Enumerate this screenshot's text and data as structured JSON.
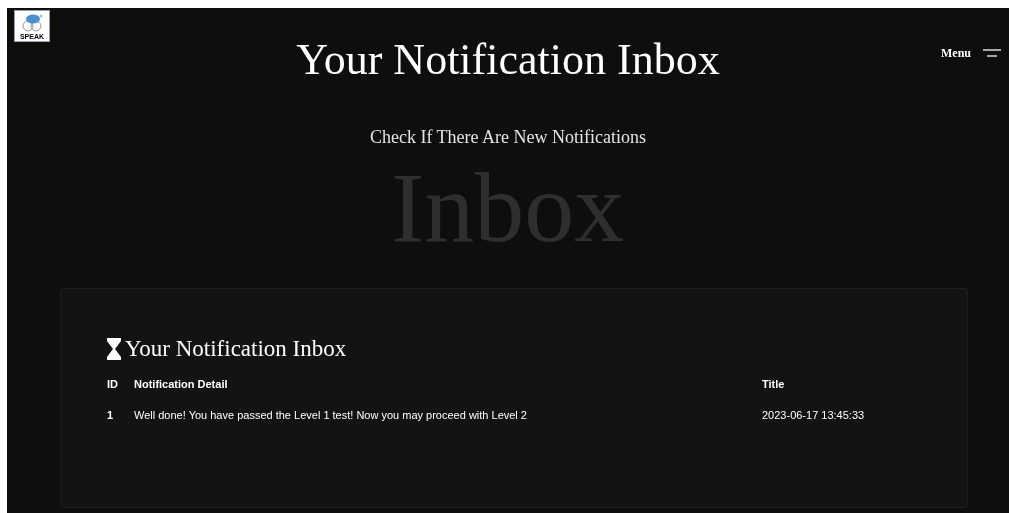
{
  "header": {
    "logo_text": "SPEAK",
    "title": "Your Notification Inbox",
    "backdrop_word": "Inbox",
    "subtitle": "Check If There Are New Notifications",
    "menu_label": "Menu"
  },
  "inbox": {
    "heading": "Your Notification Inbox",
    "table": {
      "columns": [
        "ID",
        "Notification Detail",
        "Title"
      ],
      "rows": [
        [
          "1",
          "Well done! You have passed the Level 1 test! Now you may proceed with Level 2",
          "2023-06-17 13:45:33"
        ]
      ]
    }
  }
}
